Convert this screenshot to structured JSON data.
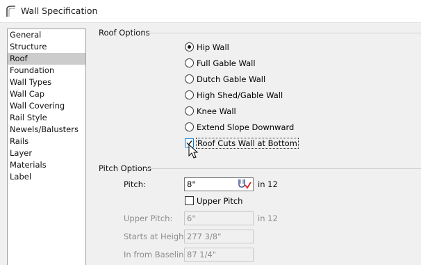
{
  "window": {
    "title": "Wall Specification"
  },
  "nav": {
    "items": [
      {
        "label": "General"
      },
      {
        "label": "Structure"
      },
      {
        "label": "Roof"
      },
      {
        "label": "Foundation"
      },
      {
        "label": "Wall Types"
      },
      {
        "label": "Wall Cap"
      },
      {
        "label": "Wall Covering"
      },
      {
        "label": "Rail Style"
      },
      {
        "label": "Newels/Balusters"
      },
      {
        "label": "Rails"
      },
      {
        "label": "Layer"
      },
      {
        "label": "Materials"
      },
      {
        "label": "Label"
      }
    ],
    "selected": "Roof"
  },
  "roof_options": {
    "heading": "Roof Options",
    "radios": [
      {
        "label": "Hip Wall",
        "checked": true
      },
      {
        "label": "Full Gable Wall",
        "checked": false
      },
      {
        "label": "Dutch Gable Wall",
        "checked": false
      },
      {
        "label": "High Shed/Gable Wall",
        "checked": false
      },
      {
        "label": "Knee Wall",
        "checked": false
      },
      {
        "label": "Extend Slope Downward",
        "checked": false
      }
    ],
    "roof_cuts": {
      "label": "Roof Cuts Wall at Bottom",
      "checked": true
    }
  },
  "pitch_options": {
    "heading": "Pitch Options",
    "pitch_label": "Pitch:",
    "pitch_value": "8\"",
    "pitch_unit": "in 12",
    "upper_pitch_check": {
      "label": "Upper Pitch",
      "checked": false
    },
    "upper_pitch_label": "Upper Pitch:",
    "upper_pitch_value": "6\"",
    "upper_pitch_unit": "in 12",
    "starts_at_label": "Starts at Height:",
    "starts_at_value": "277 3/8\"",
    "in_from_label": "In from Baseline:",
    "in_from_value": "87 1/4\""
  }
}
